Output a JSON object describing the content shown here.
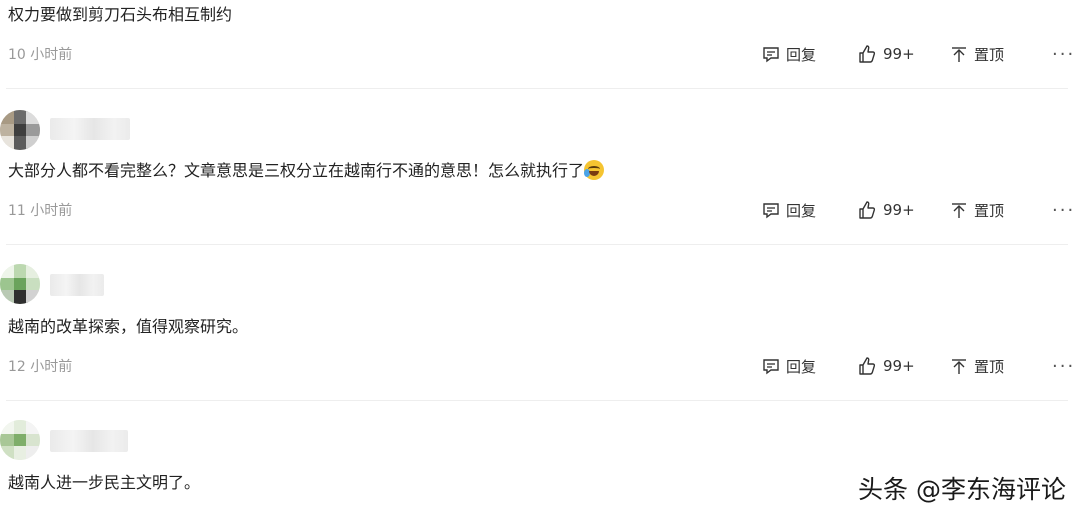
{
  "comments": [
    {
      "text": "权力要做到剪刀石头布相互制约",
      "time": "10 小时前",
      "reply_label": "回复",
      "like_count": "99+",
      "pin_label": "置顶",
      "more_label": "···"
    },
    {
      "text": "大部分人都不看完整么？文章意思是三权分立在越南行不通的意思！怎么就执行了",
      "time": "11 小时前",
      "reply_label": "回复",
      "like_count": "99+",
      "pin_label": "置顶",
      "more_label": "···"
    },
    {
      "text": "越南的改革探索，值得观察研究。",
      "time": "12 小时前",
      "reply_label": "回复",
      "like_count": "99+",
      "pin_label": "置顶",
      "more_label": "···"
    },
    {
      "text": "越南人进一步民主文明了。"
    }
  ],
  "watermark": "头条 @李东海评论",
  "icons": {
    "reply": "comment-bubble-icon",
    "like": "thumbs-up-icon",
    "pin": "pin-top-icon",
    "emoji": "crying-laughing-emoji"
  },
  "colors": {
    "time": "#999999",
    "text": "#222222",
    "divider": "#eeeeee"
  }
}
